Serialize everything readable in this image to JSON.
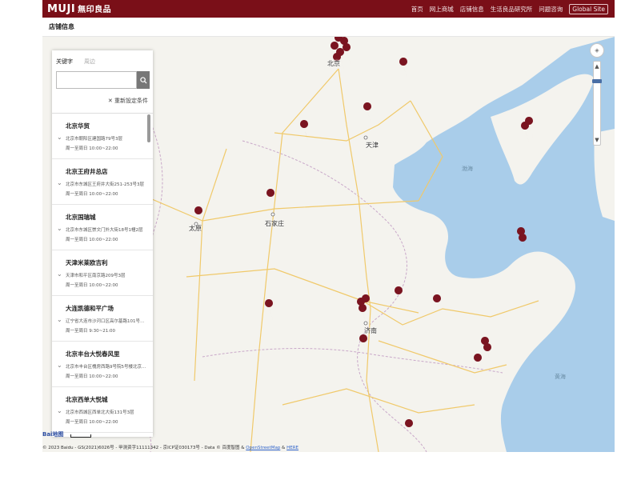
{
  "header": {
    "logo": "MUJI",
    "logo_sub": "無印良品",
    "nav": [
      "首页",
      "网上商城",
      "店铺信息",
      "生活良品研究所",
      "问题咨询",
      "Global Site"
    ]
  },
  "subheader": {
    "title": "店铺信息"
  },
  "panel": {
    "tabs": [
      "关键字",
      "周边"
    ],
    "search_placeholder": "",
    "reset_label": "✕ 重新設定条件",
    "stores": [
      {
        "name": "北京华贸",
        "address": "北京市朝阳区建国路79号3层",
        "hours": "周一至周日 10:00~22:00"
      },
      {
        "name": "北京王府井总店",
        "address": "北京市东城区王府井大街251-253号3层",
        "hours": "周一至周日 10:00~22:00"
      },
      {
        "name": "北京国瑞城",
        "address": "北京市东城区崇文门外大街18号1幢2层",
        "hours": "周一至周日 10:00~22:00"
      },
      {
        "name": "天津米莱欧吉利",
        "address": "天津市和平区南京路209号3层",
        "hours": "周一至周日 10:00~22:00"
      },
      {
        "name": "大连凯德和平广场",
        "address": "辽宁省大连市沙河口区高尔基路101号大…",
        "hours": "周一至周日 9:30~21:00"
      },
      {
        "name": "北京丰台大悦春风里",
        "address": "北京市丰台区槐房西路9号院5号楼北京丰…",
        "hours": "周一至周日 10:00~22:00"
      },
      {
        "name": "北京西单大悦城",
        "address": "北京市西城区西单北大街131号3层",
        "hours": "周一至周日 10:00~22:00"
      }
    ]
  },
  "map": {
    "cities": [
      "天津",
      "石家庄",
      "太原",
      "济南",
      "北京"
    ],
    "sea_labels": [
      "渤海",
      "黄海"
    ],
    "pin_color": "#7a1420",
    "water_color": "#a9cdea",
    "land_color": "#f4f3ee"
  },
  "footer": {
    "baidu": "Bai地图",
    "attribution_prefix": "© 2023 Baidu - GS(2021)6026号 - 甲测资字11111342 - 京ICP证030173号 - Data © 百度智图 & ",
    "osm": "OpenStreetMap",
    "amp": " & ",
    "here": "HERE"
  }
}
